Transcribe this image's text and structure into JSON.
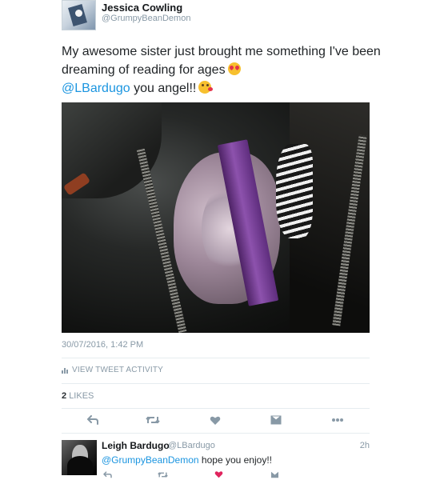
{
  "tweet": {
    "author": {
      "name": "Jessica Cowling",
      "handle": "@GrumpyBeanDemon"
    },
    "text_line1": "My awesome sister just brought me something I've been",
    "text_line2": "dreaming of reading for ages",
    "mention": "@LBardugo",
    "text_line3": "you angel!!",
    "emoji_1": "heart-eyes-emoji",
    "emoji_2": "kiss-emoji",
    "timestamp": "30/07/2016, 1:42 PM",
    "activity_label": "VIEW TWEET ACTIVITY",
    "likes_count": "2",
    "likes_label": "LIKES",
    "actions": [
      "reply-icon",
      "retweet-icon",
      "heart-icon",
      "message-icon",
      "more-icon"
    ]
  },
  "reply": {
    "author": {
      "name": "Leigh Bardugo",
      "handle": "@LBardugo"
    },
    "time": "2h",
    "mention": "@GrumpyBeanDemon",
    "text": "hope you enjoy!!",
    "liked": true
  },
  "colors": {
    "link": "#1b95e0",
    "muted": "#8899a6",
    "like_active": "#e0245e",
    "text": "#1f2326"
  }
}
